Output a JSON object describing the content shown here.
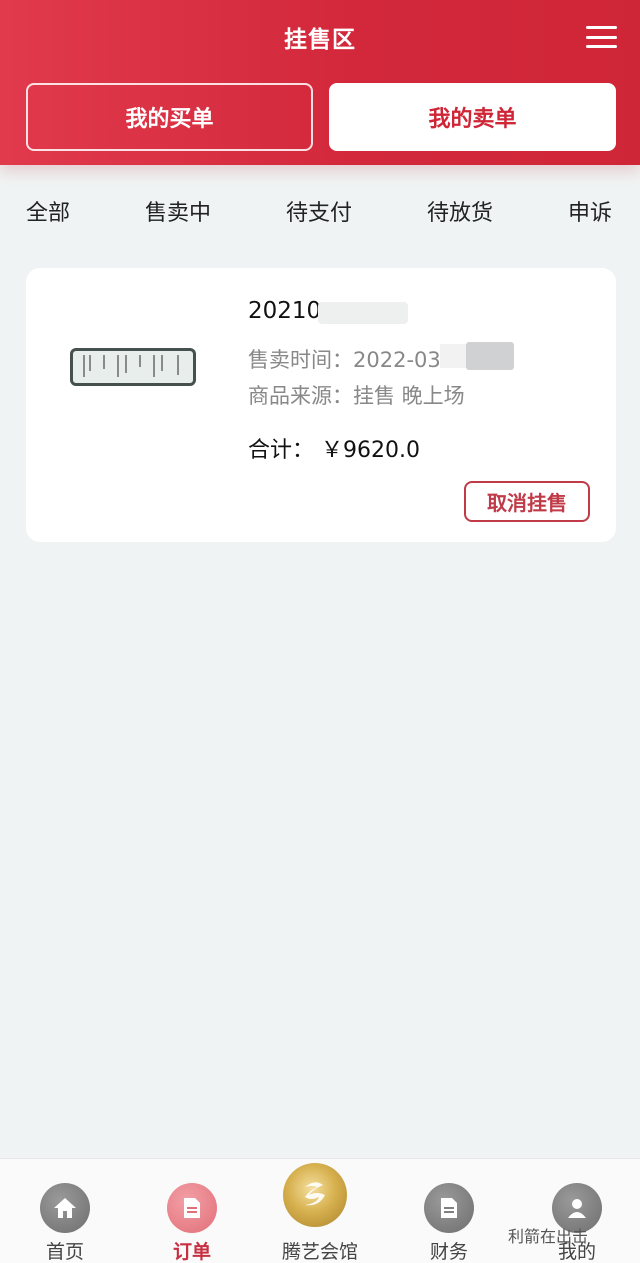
{
  "header": {
    "title": "挂售区",
    "menu_icon": "hamburger-menu-icon",
    "buy_tab": "我的买单",
    "sell_tab": "我的卖单",
    "active_tab": "sell",
    "accent_color": "#d3283c"
  },
  "filters": [
    {
      "label": "全部"
    },
    {
      "label": "售卖中"
    },
    {
      "label": "待支付"
    },
    {
      "label": "待放货"
    },
    {
      "label": "申诉"
    }
  ],
  "order": {
    "order_no": "20210",
    "sale_time": "售卖时间：2022-03",
    "source": "商品来源：挂售 晚上场",
    "total": "合计： ￥9620.0",
    "cancel_label": "取消挂售",
    "thumbnail": "calligraphy-scroll-image"
  },
  "bottom_nav": [
    {
      "label": "首页",
      "icon": "home-icon"
    },
    {
      "label": "订单",
      "icon": "document-icon",
      "active": true
    },
    {
      "label": "腾艺会馆",
      "icon": "club-logo-icon"
    },
    {
      "label": "财务",
      "icon": "finance-document-icon"
    },
    {
      "label": "我的",
      "icon": "user-icon"
    }
  ],
  "watermark": "利箭在出击"
}
